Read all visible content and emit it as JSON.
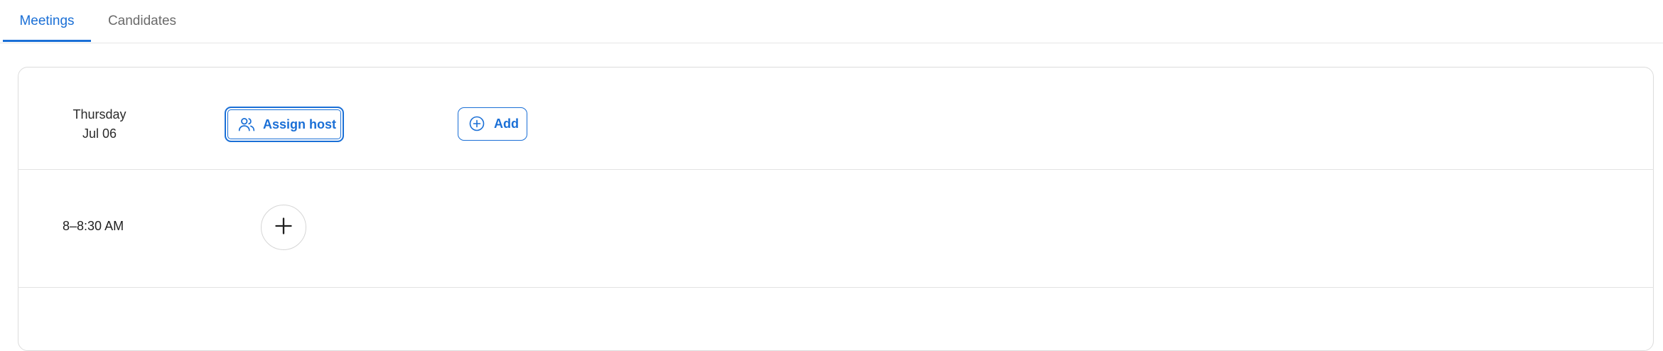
{
  "tabs": {
    "meetings": "Meetings",
    "candidates": "Candidates"
  },
  "day": {
    "weekday": "Thursday",
    "date": "Jul 06"
  },
  "actions": {
    "assign_host": "Assign host",
    "add": "Add"
  },
  "slots": [
    {
      "time": "8–8:30 AM"
    }
  ],
  "colors": {
    "accent": "#1a6fd6",
    "border": "#dcdcdc"
  }
}
